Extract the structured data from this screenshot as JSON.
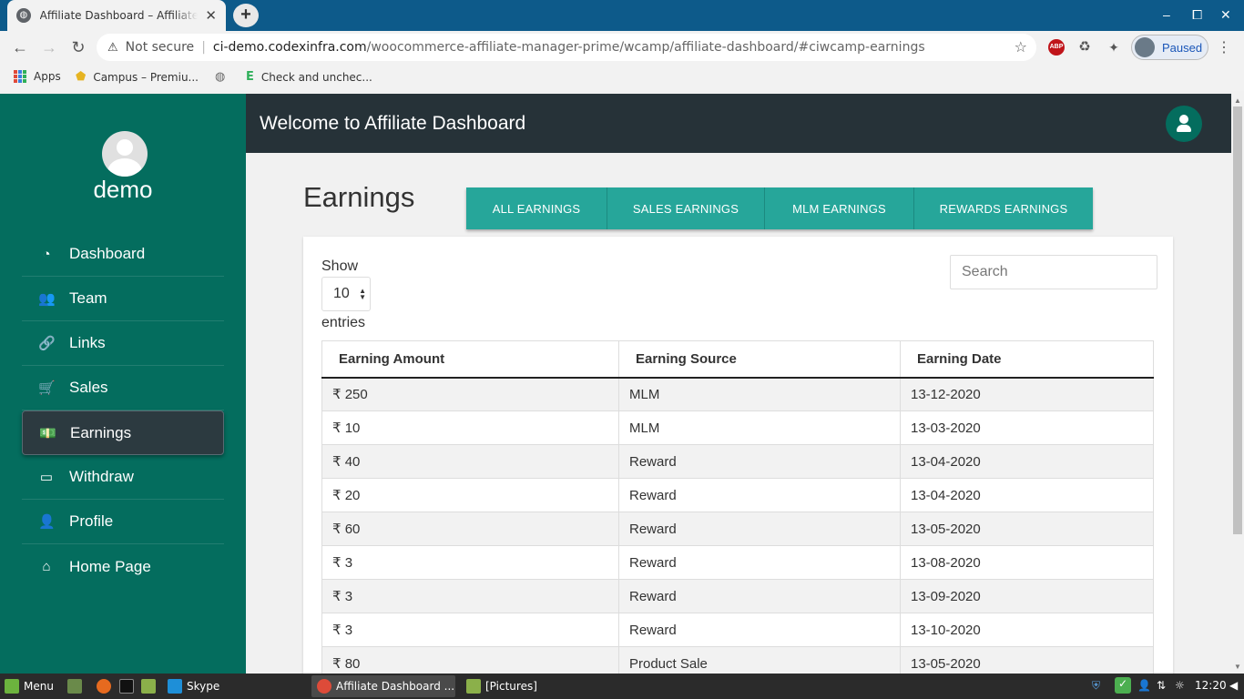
{
  "browser": {
    "tab_title": "Affiliate Dashboard – Affiliate Manager",
    "tab_close": "✕",
    "new_tab": "+",
    "window_controls": {
      "minimize": "–",
      "maximize": "⧠",
      "close": "✕"
    },
    "nav": {
      "back": "←",
      "forward": "→",
      "reload": "↻"
    },
    "security_label": "Not secure",
    "url_host": "ci-demo.codexinfra.com",
    "url_path": "/woocommerce-affiliate-manager-prime/wcamp/affiliate-dashboard/#ciwcamp-earnings",
    "profile_status": "Paused",
    "extensions": {
      "abp": "ABP"
    },
    "bookmarks": [
      {
        "label": "Apps",
        "icon": "apps-grid-icon"
      },
      {
        "label": "Campus – Premiu...",
        "icon": "campus-icon"
      },
      {
        "label": "",
        "icon": "globe-icon"
      },
      {
        "label": "Check and unchec...",
        "icon": "e-logo-icon"
      }
    ]
  },
  "sidebar": {
    "username": "demo",
    "items": [
      {
        "label": "Dashboard",
        "icon": "◔",
        "active": false
      },
      {
        "label": "Team",
        "icon": "👥",
        "active": false
      },
      {
        "label": "Links",
        "icon": "🔗",
        "active": false
      },
      {
        "label": "Sales",
        "icon": "🛒",
        "active": false
      },
      {
        "label": "Earnings",
        "icon": "💵",
        "active": true
      },
      {
        "label": "Withdraw",
        "icon": "▭",
        "active": false
      },
      {
        "label": "Profile",
        "icon": "👤",
        "active": false
      },
      {
        "label": "Home Page",
        "icon": "⌂",
        "active": false
      }
    ]
  },
  "header": {
    "welcome": "Welcome to Affiliate Dashboard"
  },
  "main": {
    "title": "Earnings",
    "tabs": [
      "ALL EARNINGS",
      "SALES EARNINGS",
      "MLM EARNINGS",
      "REWARDS EARNINGS"
    ],
    "show_label": "Show",
    "entries_value": "10",
    "entries_label": "entries",
    "search_placeholder": "Search",
    "table": {
      "columns": [
        "Earning Amount",
        "Earning Source",
        "Earning Date"
      ],
      "rows": [
        [
          "₹ 250",
          "MLM",
          "13-12-2020"
        ],
        [
          "₹ 10",
          "MLM",
          "13-03-2020"
        ],
        [
          "₹ 40",
          "Reward",
          "13-04-2020"
        ],
        [
          "₹ 20",
          "Reward",
          "13-04-2020"
        ],
        [
          "₹ 60",
          "Reward",
          "13-05-2020"
        ],
        [
          "₹ 3",
          "Reward",
          "13-08-2020"
        ],
        [
          "₹ 3",
          "Reward",
          "13-09-2020"
        ],
        [
          "₹ 3",
          "Reward",
          "13-10-2020"
        ],
        [
          "₹ 80",
          "Product Sale",
          "13-05-2020"
        ]
      ]
    }
  },
  "taskbar": {
    "menu_label": "Menu",
    "apps": [
      {
        "label": "Skype",
        "color": "#1e8fd8"
      }
    ],
    "windows": [
      {
        "label": "Affiliate Dashboard ...",
        "active": true
      },
      {
        "label": "[Pictures]",
        "active": false
      }
    ],
    "clock": "12:20"
  },
  "colors": {
    "sidebar": "#046d5e",
    "header": "#263238",
    "tab_buttons": "#26a69a",
    "chrome_titlebar": "#0d5a8a"
  }
}
